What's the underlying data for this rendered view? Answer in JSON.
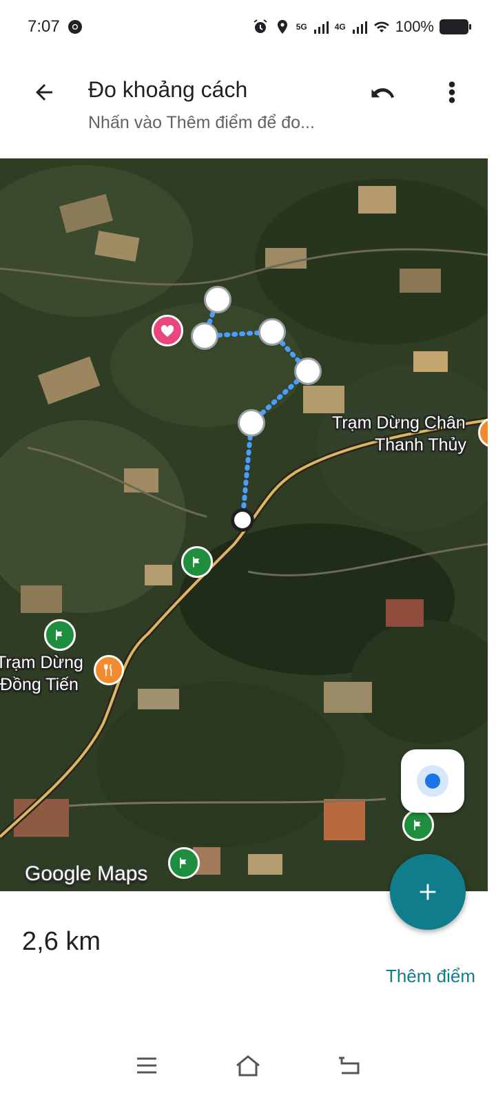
{
  "status_bar": {
    "time": "7:07",
    "battery": "100%",
    "network_1": "5G",
    "network_2": "4G"
  },
  "header": {
    "title": "Đo khoảng cách",
    "subtitle": "Nhấn vào Thêm điểm để đo..."
  },
  "map": {
    "labels": {
      "tram_dung_chan_line1": "Trạm Dừng Chân",
      "tram_dung_chan_line2": "Thanh Thủy",
      "tram_dung_dong_tien_line1": "Trạm Dừng",
      "tram_dung_dong_tien_line2": "Đồng Tiến"
    },
    "logo": "Google Maps",
    "route_color": "#4a9eff"
  },
  "measurement": {
    "distance": "2,6 km",
    "add_point_label": "Thêm điểm"
  },
  "colors": {
    "accent": "#0f7d8c",
    "accent_text": "#137c8b",
    "pin_green": "#1e8e3e",
    "pin_orange": "#f28b30",
    "pin_heart": "#e8467c"
  }
}
